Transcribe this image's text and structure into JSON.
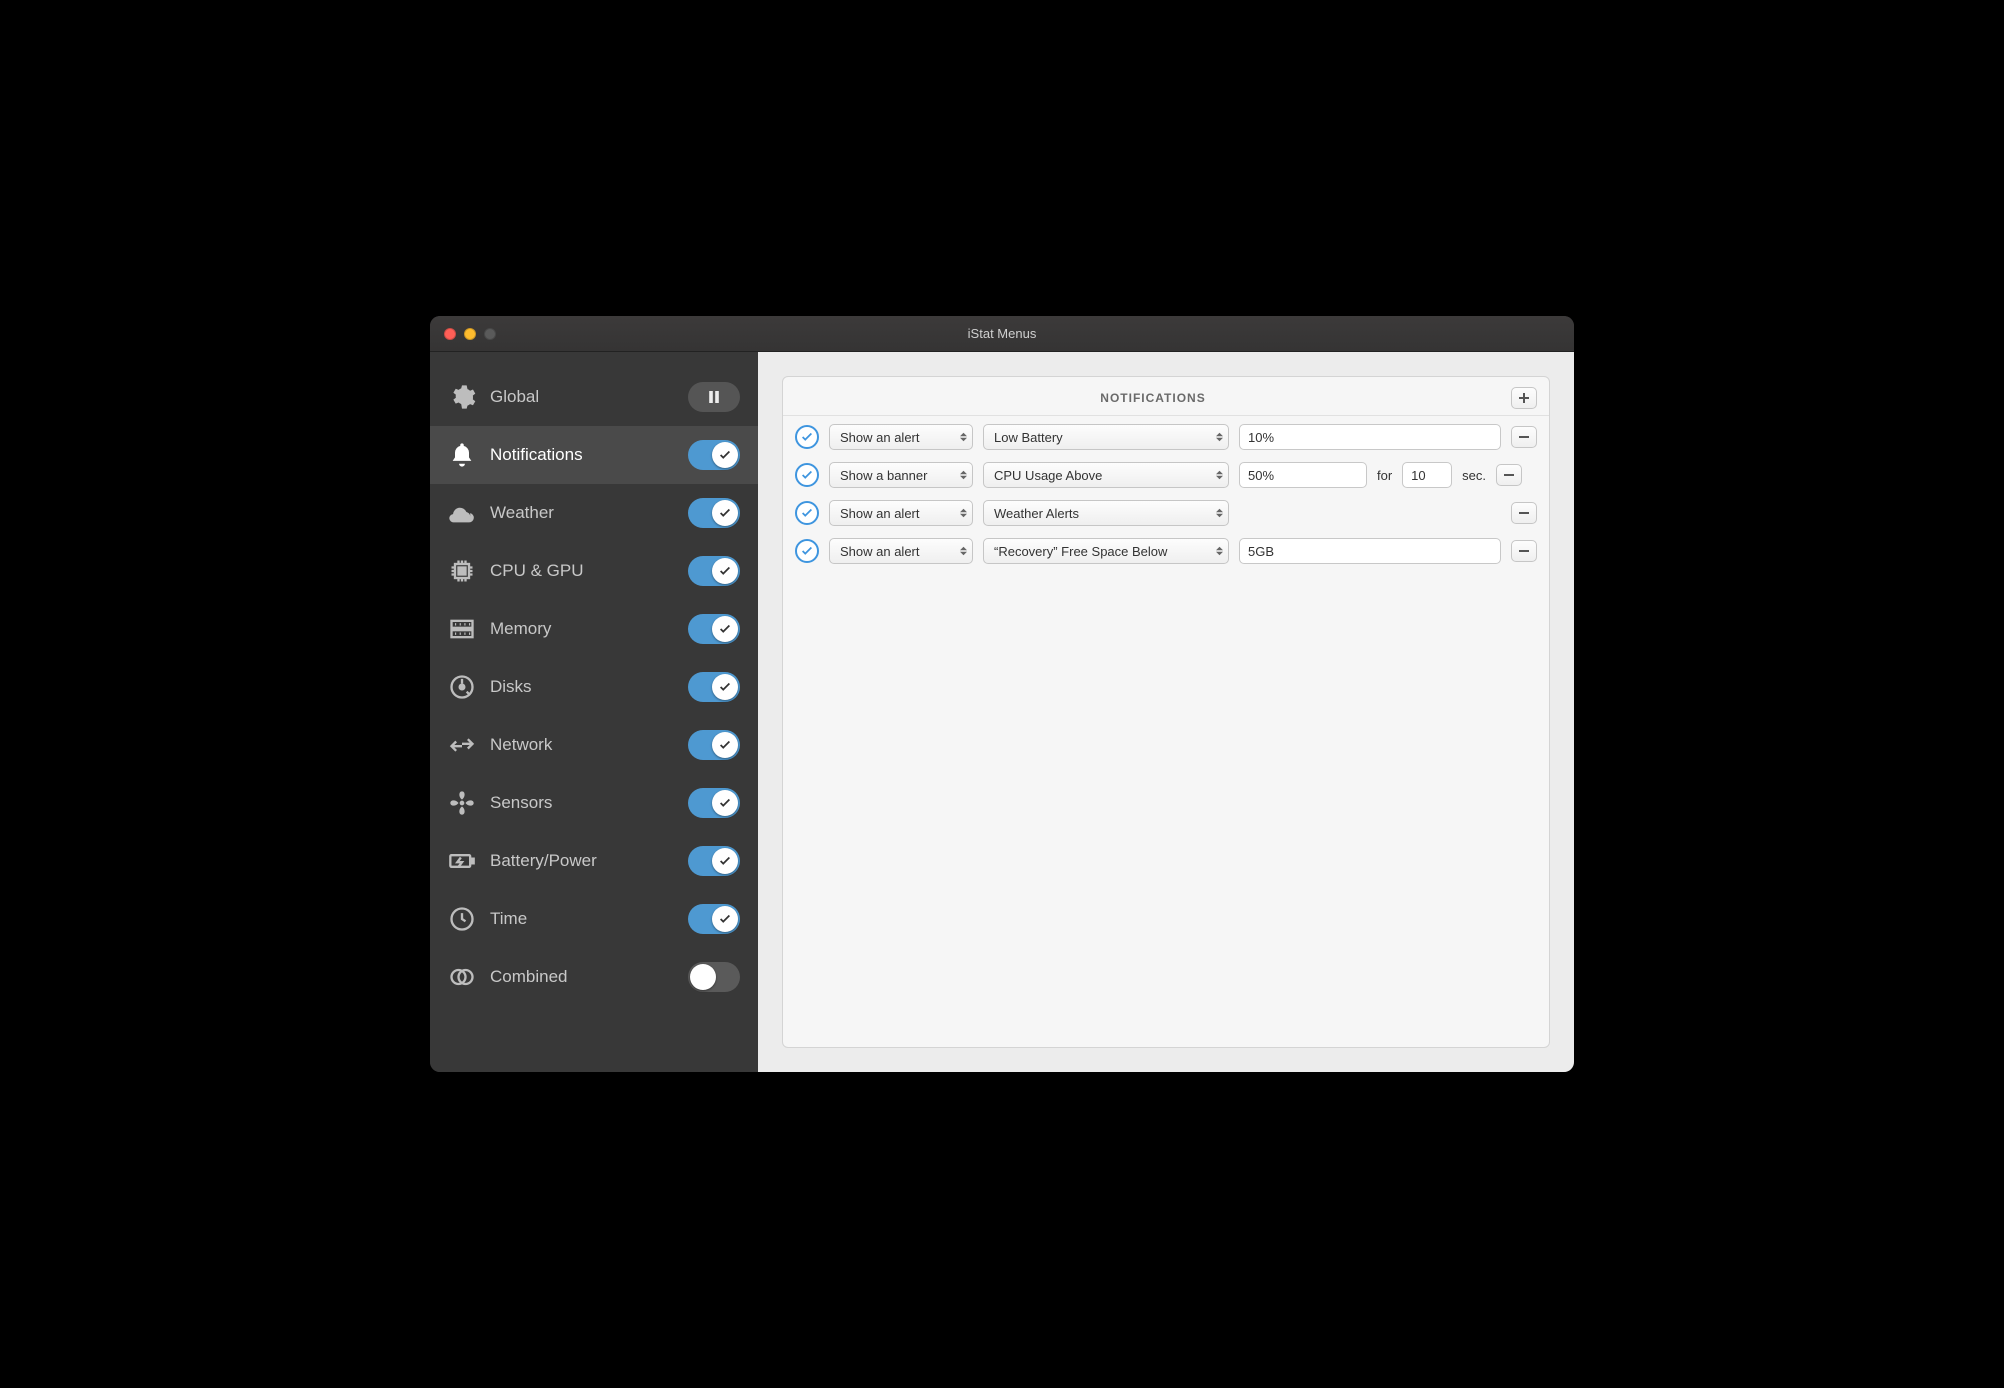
{
  "window": {
    "title": "iStat Menus"
  },
  "sidebar": {
    "items": [
      {
        "id": "global",
        "label": "Global",
        "control": "pause"
      },
      {
        "id": "notifications",
        "label": "Notifications",
        "control": "toggle",
        "on": true,
        "selected": true
      },
      {
        "id": "weather",
        "label": "Weather",
        "control": "toggle",
        "on": true
      },
      {
        "id": "cpu",
        "label": "CPU & GPU",
        "control": "toggle",
        "on": true
      },
      {
        "id": "memory",
        "label": "Memory",
        "control": "toggle",
        "on": true
      },
      {
        "id": "disks",
        "label": "Disks",
        "control": "toggle",
        "on": true
      },
      {
        "id": "network",
        "label": "Network",
        "control": "toggle",
        "on": true
      },
      {
        "id": "sensors",
        "label": "Sensors",
        "control": "toggle",
        "on": true
      },
      {
        "id": "battery",
        "label": "Battery/Power",
        "control": "toggle",
        "on": true
      },
      {
        "id": "time",
        "label": "Time",
        "control": "toggle",
        "on": true
      },
      {
        "id": "combined",
        "label": "Combined",
        "control": "toggle",
        "on": false
      }
    ]
  },
  "panel": {
    "title": "NOTIFICATIONS",
    "rules": [
      {
        "action": "Show an alert",
        "trigger": "Low Battery",
        "value": "10%"
      },
      {
        "action": "Show a banner",
        "trigger": "CPU Usage Above",
        "value": "50%",
        "for_label": "for",
        "duration": "10",
        "sec_label": "sec."
      },
      {
        "action": "Show an alert",
        "trigger": "Weather Alerts"
      },
      {
        "action": "Show an alert",
        "trigger": "“Recovery” Free Space Below",
        "value": "5GB"
      }
    ]
  }
}
